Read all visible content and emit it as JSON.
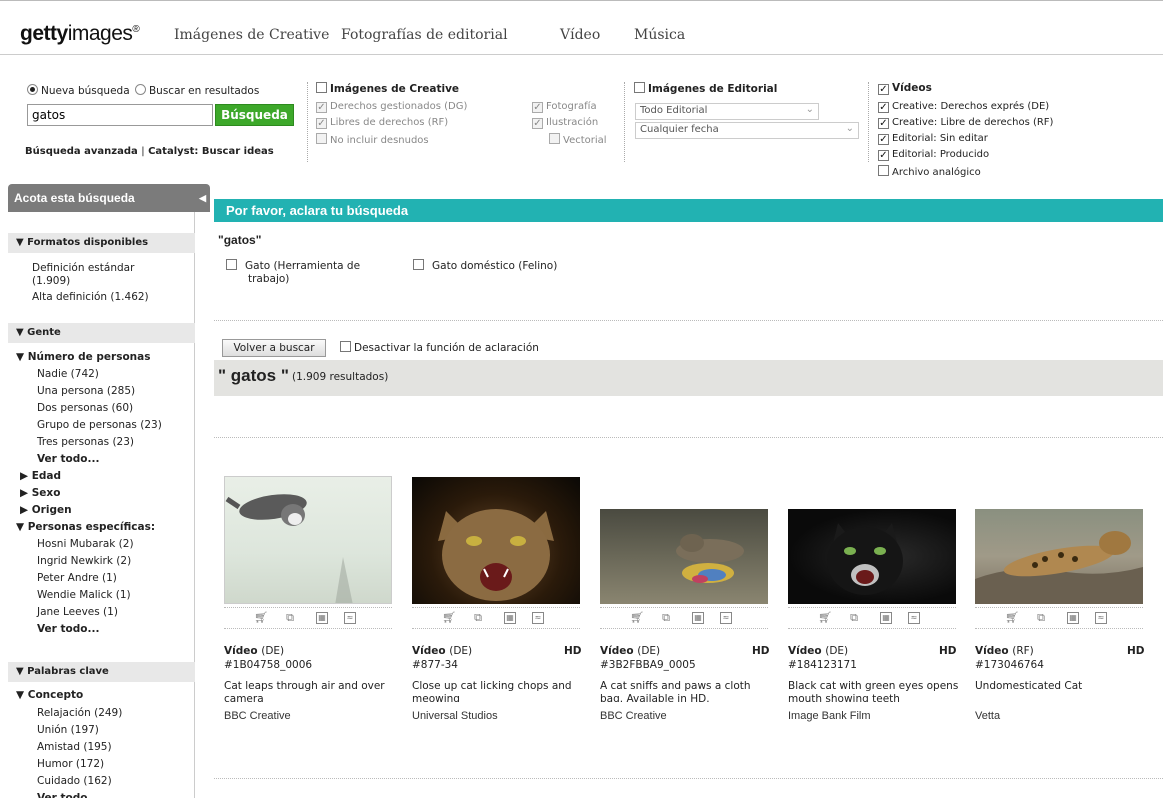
{
  "header": {
    "logo_bold": "getty",
    "logo_light": "images",
    "logo_reg": "®",
    "nav": [
      "Imágenes de Creative",
      "Fotografías de editorial",
      "Vídeo",
      "Música"
    ]
  },
  "search": {
    "radio_new": "Nueva búsqueda",
    "radio_within": "Buscar en resultados",
    "query": "gatos",
    "button": "Búsqueda",
    "advanced": "Búsqueda avanzada",
    "separator": "|",
    "catalyst": "Catalyst: Buscar ideas"
  },
  "creative": {
    "title": "Imágenes de Creative",
    "options": [
      "Derechos gestionados (DG)",
      "Libres de derechos (RF)",
      "No incluir desnudos"
    ],
    "types": [
      "Fotografía",
      "Ilustración",
      "Vectorial"
    ]
  },
  "editorial": {
    "title": "Imágenes de Editorial",
    "select1": "Todo Editorial",
    "select2": "Cualquier fecha"
  },
  "videos": {
    "title": "Vídeos",
    "options": [
      "Creative: Derechos exprés (DE)",
      "Creative: Libre de derechos (RF)",
      "Editorial: Sin editar",
      "Editorial: Producido",
      "Archivo analógico"
    ],
    "checked": [
      true,
      true,
      true,
      true,
      false
    ]
  },
  "sidebar": {
    "title": "Acota esta búsqueda",
    "formats_head": "Formatos disponibles",
    "formats": [
      "Definición estándar",
      "(1.909)",
      "Alta definición (1.462)"
    ],
    "people_head": "Gente",
    "num_people_head": "Número de personas",
    "num_people": [
      "Nadie (742)",
      "Una persona (285)",
      "Dos personas (60)",
      "Grupo de personas (23)",
      "Tres personas (23)"
    ],
    "see_all": "Ver todo...",
    "collapsed": [
      "Edad",
      "Sexo",
      "Origen"
    ],
    "specific_head": "Personas específicas:",
    "specific": [
      "Hosni Mubarak (2)",
      "Ingrid Newkirk (2)",
      "Peter Andre (1)",
      "Wendie Malick (1)",
      "Jane Leeves (1)"
    ],
    "keywords_head": "Palabras clave",
    "concept_head": "Concepto",
    "concept": [
      "Relajación (249)",
      "Unión (197)",
      "Amistad (195)",
      "Humor (172)",
      "Cuidado (162)"
    ]
  },
  "clarify": {
    "bar": "Por favor, aclara tu búsqueda",
    "term": "\"gatos\"",
    "option1_line1": "Gato (Herramienta de",
    "option1_line2": "trabajo)",
    "option2": "Gato doméstico (Felino)",
    "back_button": "Volver a buscar",
    "disable": "Desactivar la función de aclaración"
  },
  "results": {
    "query": "\" gatos \"",
    "count": "(1.909 resultados)"
  },
  "cards": [
    {
      "type": "Vídeo",
      "lic": "(DE)",
      "hd": "",
      "id": "#1B04758_0006",
      "desc": "Cat leaps through air and over camera",
      "src": "BBC Creative"
    },
    {
      "type": "Vídeo",
      "lic": "(DE)",
      "hd": "HD",
      "id": "#877-34",
      "desc": "Close up cat licking chops and meowing",
      "src": "Universal Studios"
    },
    {
      "type": "Vídeo",
      "lic": "(DE)",
      "hd": "HD",
      "id": "#3B2FBBA9_0005",
      "desc": "A cat sniffs and paws a cloth bag. Available in HD.",
      "src": "BBC Creative"
    },
    {
      "type": "Vídeo",
      "lic": "(DE)",
      "hd": "HD",
      "id": "#184123171",
      "desc": "Black cat with green eyes opens mouth showing teeth",
      "src": "Image Bank Film"
    },
    {
      "type": "Vídeo",
      "lic": "(RF)",
      "hd": "HD",
      "id": "#173046764",
      "desc": "Undomesticated Cat",
      "src": "Vetta"
    }
  ]
}
